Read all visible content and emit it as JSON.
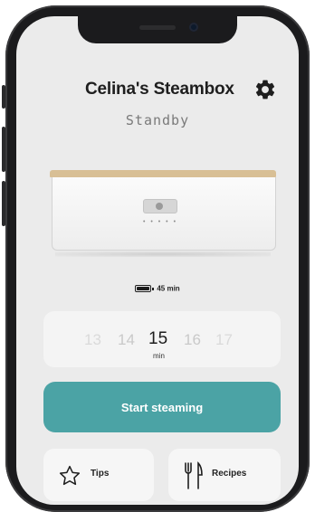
{
  "app": {
    "title": "Celina's Steambox",
    "status": "Standby"
  },
  "battery": {
    "level": 0.85,
    "remaining": "45 min"
  },
  "time_picker": {
    "values": [
      "13",
      "14",
      "15",
      "16",
      "17"
    ],
    "selected_index": 2,
    "unit": "min"
  },
  "actions": {
    "start_label": "Start steaming",
    "tips_label": "Tips",
    "recipes_label": "Recipes"
  },
  "colors": {
    "accent": "#4ba3a5",
    "lid_wood": "#d8bf95"
  },
  "icons": {
    "settings": "gear-icon",
    "tips": "star-outline-icon",
    "recipes": "fork-knife-icon",
    "battery": "battery-icon"
  }
}
